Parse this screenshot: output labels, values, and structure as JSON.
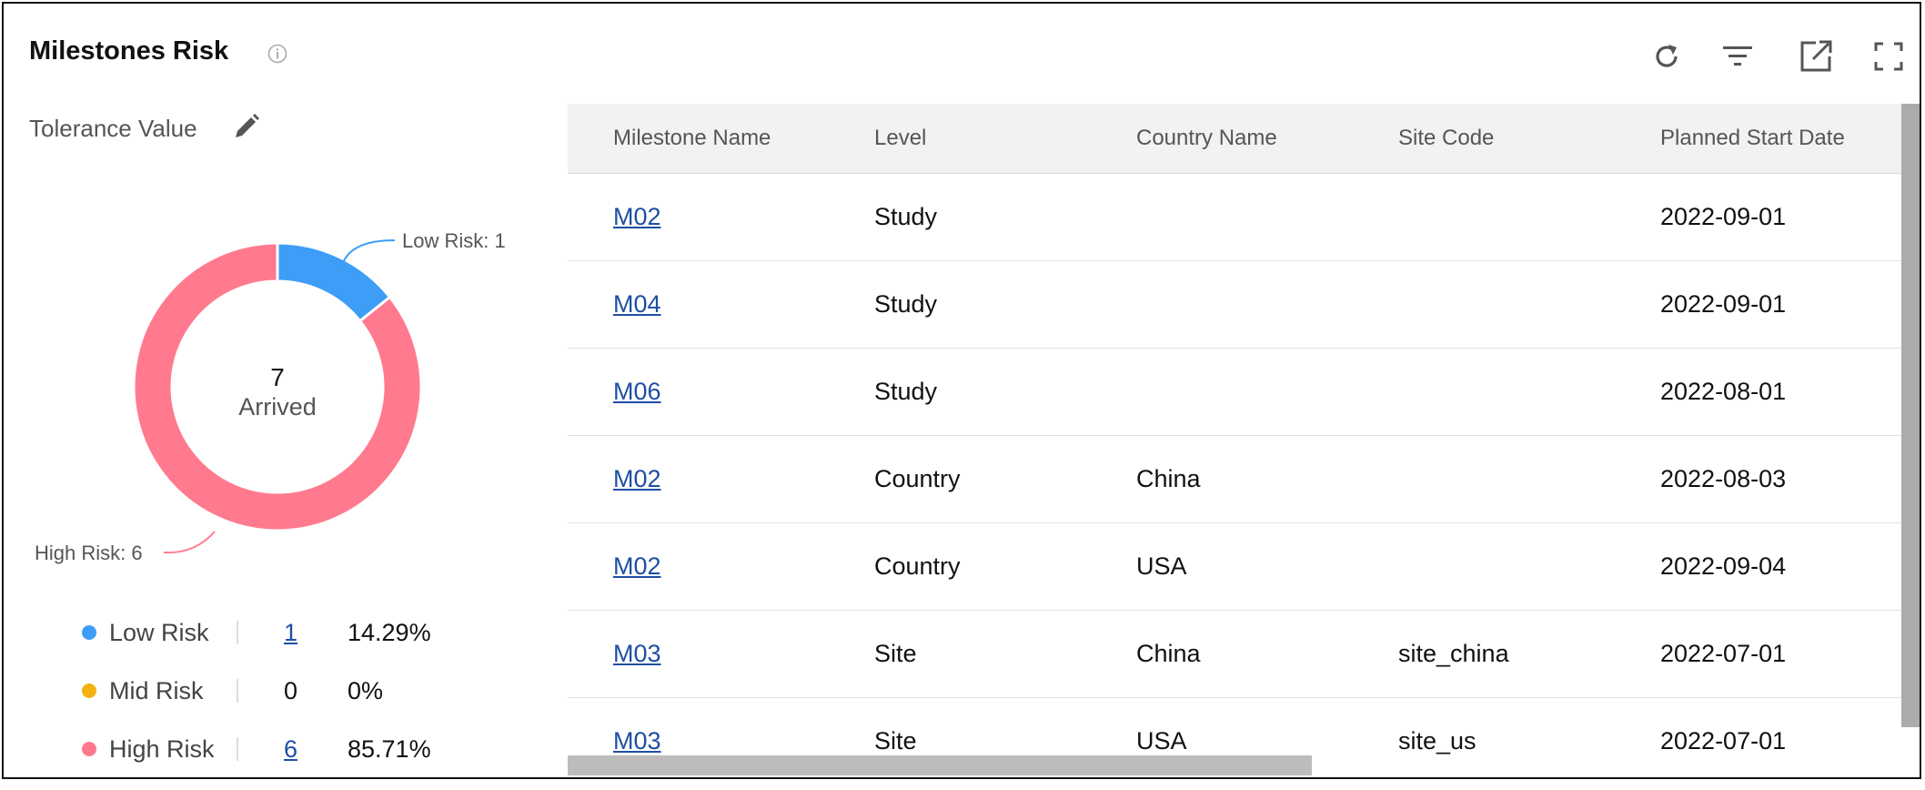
{
  "widget": {
    "title": "Milestones Risk"
  },
  "tolerance": {
    "label": "Tolerance Value"
  },
  "toolbar": {
    "refresh_icon": "refresh-icon",
    "filter_icon": "filter-icon",
    "open_icon": "open-external-icon",
    "fullscreen_icon": "fullscreen-icon"
  },
  "donut": {
    "center_value": "7",
    "center_label": "Arrived",
    "callout_low": "Low Risk: 1",
    "callout_high": "High Risk: 6"
  },
  "chart_data": {
    "type": "pie",
    "categories": [
      "Low Risk",
      "Mid Risk",
      "High Risk"
    ],
    "values": [
      1,
      0,
      6
    ],
    "colors": {
      "low": "#3d9df7",
      "mid": "#f3b20f",
      "high": "#ff7a8e"
    }
  },
  "legend": [
    {
      "label": "Low Risk",
      "count": "1",
      "pct": "14.29%",
      "color": "#3d9df7",
      "link": true
    },
    {
      "label": "Mid Risk",
      "count": "0",
      "pct": "0%",
      "color": "#f3b20f",
      "link": false
    },
    {
      "label": "High Risk",
      "count": "6",
      "pct": "85.71%",
      "color": "#ff7a8e",
      "link": true
    }
  ],
  "table": {
    "headers": [
      "Milestone Name",
      "Level",
      "Country Name",
      "Site Code",
      "Planned Start Date"
    ],
    "rows": [
      {
        "name": "M02",
        "level": "Study",
        "country": "",
        "site": "",
        "date": "2022-09-01"
      },
      {
        "name": "M04",
        "level": "Study",
        "country": "",
        "site": "",
        "date": "2022-09-01"
      },
      {
        "name": "M06",
        "level": "Study",
        "country": "",
        "site": "",
        "date": "2022-08-01"
      },
      {
        "name": "M02",
        "level": "Country",
        "country": "China",
        "site": "",
        "date": "2022-08-03"
      },
      {
        "name": "M02",
        "level": "Country",
        "country": "USA",
        "site": "",
        "date": "2022-09-04"
      },
      {
        "name": "M03",
        "level": "Site",
        "country": "China",
        "site": "site_china",
        "date": "2022-07-01"
      },
      {
        "name": "M03",
        "level": "Site",
        "country": "USA",
        "site": "site_us",
        "date": "2022-07-01"
      }
    ]
  }
}
